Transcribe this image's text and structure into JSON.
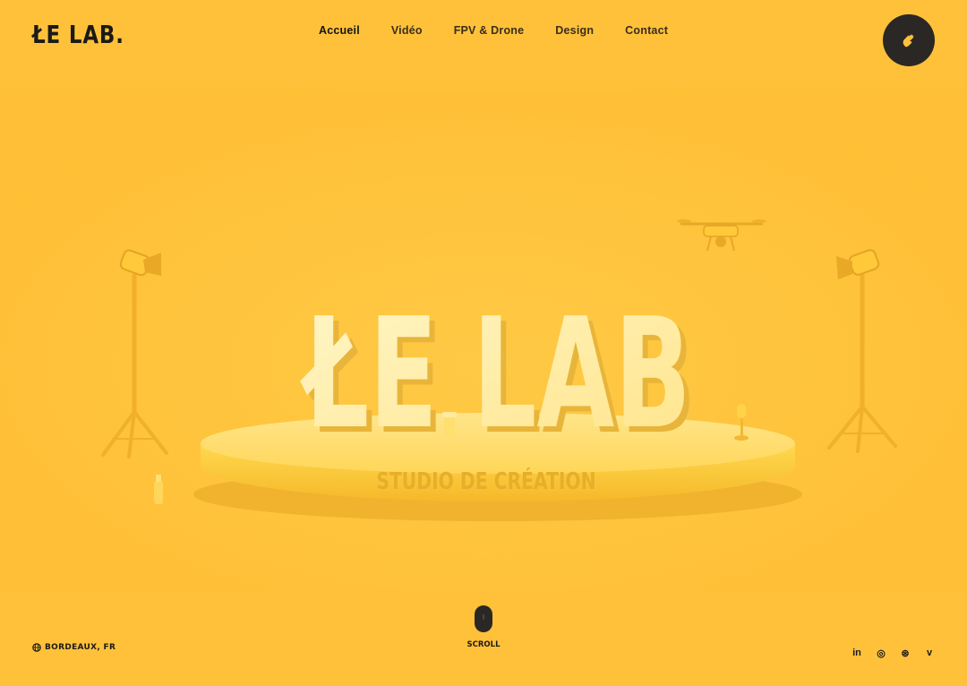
{
  "header": {
    "logo": "ŁE LAB.",
    "nav": [
      {
        "label": "Accueil",
        "active": true
      },
      {
        "label": "Vidéo",
        "active": false
      },
      {
        "label": "FPV & Drone",
        "active": false
      },
      {
        "label": "Design",
        "active": false
      },
      {
        "label": "Contact",
        "active": false
      }
    ],
    "contact_icon": "waving-hand-icon"
  },
  "hero": {
    "title": "ŁE LAB",
    "subtitle": "STUDIO DE CRÉATION"
  },
  "footer": {
    "location": "BORDEAUX, FR",
    "location_icon": "globe-icon",
    "scroll_label": "SCROLL",
    "socials": [
      {
        "name": "linkedin-icon",
        "glyph": "in"
      },
      {
        "name": "instagram-icon",
        "glyph": "◎"
      },
      {
        "name": "dribbble-icon",
        "glyph": "⊛"
      },
      {
        "name": "vimeo-icon",
        "glyph": "v"
      }
    ]
  },
  "colors": {
    "background": "#FFC13A",
    "dark": "#2b2724",
    "letters": "#FFEFA8",
    "stage": "#FFD84E"
  }
}
